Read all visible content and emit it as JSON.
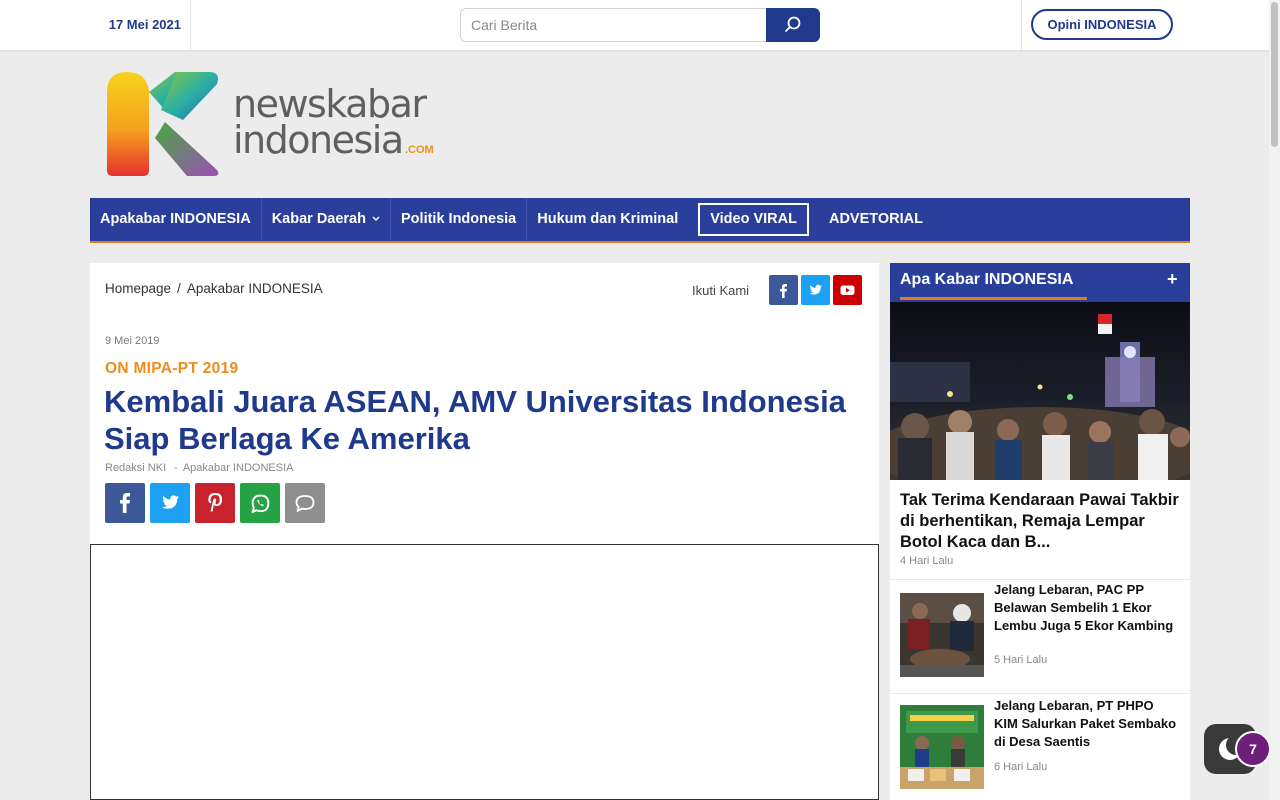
{
  "topbar": {
    "date": "17 Mei 2021",
    "search_placeholder": "Cari Berita",
    "opini_label": "Opini INDONESIA"
  },
  "logo": {
    "word1": "newskabar",
    "word2": "indonesia",
    "suffix": ".COM"
  },
  "nav": {
    "items": [
      {
        "label": "Apakabar INDONESIA"
      },
      {
        "label": "Kabar Daerah"
      },
      {
        "label": "Politik Indonesia"
      },
      {
        "label": "Hukum dan Kriminal"
      },
      {
        "label": "Video VIRAL"
      },
      {
        "label": "ADVETORIAL"
      }
    ]
  },
  "article": {
    "breadcrumb": [
      "Homepage",
      "Apakabar INDONESIA"
    ],
    "breadcrumb_sep": "/",
    "follow_label": "Ikuti Kami",
    "date": "9 Mei 2019",
    "kicker": "ON MIPA-PT 2019",
    "headline": "Kembali Juara ASEAN, AMV Universitas Indonesia Siap Berlaga Ke Amerika",
    "author": "Redaksi NKI",
    "byline_sep": "-",
    "category": "Apakabar INDONESIA"
  },
  "sidebar": {
    "title": "Apa Kabar INDONESIA",
    "expand_label": "+",
    "featured": {
      "title": "Tak Terima Kendaraan Pawai Takbir di berhentikan, Remaja Lempar Botol Kaca dan B...",
      "time": "4 Hari Lalu"
    },
    "items": [
      {
        "title": "Jelang Lebaran, PAC PP Belawan Sembelih 1 Ekor Lembu Juga 5 Ekor Kambing",
        "time": "5 Hari Lalu"
      },
      {
        "title": "Jelang Lebaran, PT PHPO KIM Salurkan Paket Sembako di Desa Saentis",
        "time": "6 Hari Lalu"
      }
    ]
  },
  "notification_count": "7",
  "colors": {
    "brand_blue": "#2a3f9c",
    "accent_orange": "#f08a1d",
    "headline_blue": "#1f3a8c",
    "facebook": "#3b5998",
    "twitter": "#1da1f2",
    "youtube": "#cc0000",
    "pinterest": "#c8232c",
    "whatsapp": "#25a244"
  },
  "icons": [
    "search-icon",
    "chevron-down-icon",
    "facebook-icon",
    "twitter-icon",
    "youtube-icon",
    "pinterest-icon",
    "whatsapp-icon",
    "comment-icon",
    "moon-icon"
  ]
}
